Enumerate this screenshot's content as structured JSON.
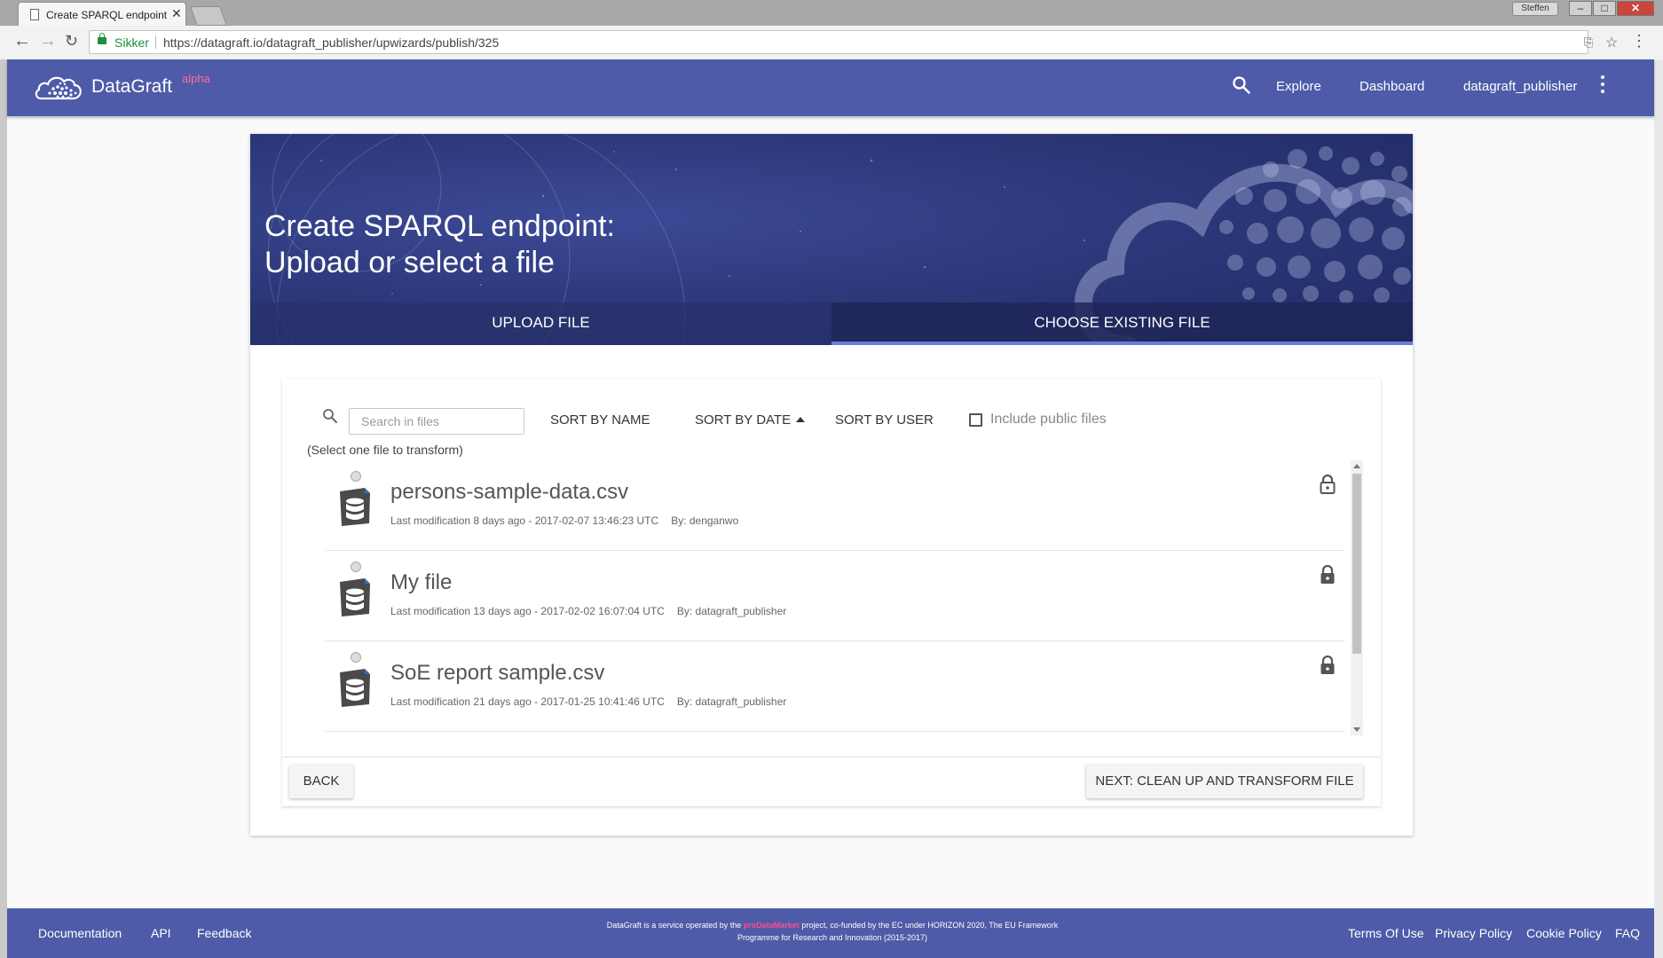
{
  "browser": {
    "tab_title": "Create SPARQL endpoint",
    "user_badge": "Steffen",
    "secure_label": "Sikker",
    "url": "https://datagraft.io/datagraft_publisher/upwizards/publish/325"
  },
  "header": {
    "brand": "DataGraft",
    "brand_sup": "alpha",
    "nav": [
      "Explore",
      "Dashboard",
      "datagraft_publisher"
    ]
  },
  "hero": {
    "title_line1": "Create SPARQL endpoint:",
    "title_line2": "Upload or select a file",
    "tabs": [
      "UPLOAD FILE",
      "CHOOSE EXISTING FILE"
    ],
    "active_tab": "CHOOSE EXISTING FILE"
  },
  "filters": {
    "search_placeholder": "Search in files",
    "sort_name": "SORT BY NAME",
    "sort_date": "SORT BY DATE",
    "sort_user": "SORT BY USER",
    "include_public": "Include public files",
    "include_public_checked": false,
    "hint": "(Select one file to transform)"
  },
  "files": [
    {
      "name": "persons-sample-data.csv",
      "modified": "Last modification 8 days ago - 2017-02-07 13:46:23 UTC",
      "by": "By: denganwo",
      "lock": "unlocked"
    },
    {
      "name": "My file",
      "modified": "Last modification 13 days ago - 2017-02-02 16:07:04 UTC",
      "by": "By: datagraft_publisher",
      "lock": "locked"
    },
    {
      "name": "SoE report sample.csv",
      "modified": "Last modification 21 days ago - 2017-01-25 10:41:46 UTC",
      "by": "By: datagraft_publisher",
      "lock": "locked"
    }
  ],
  "actions": {
    "back": "BACK",
    "next": "NEXT: CLEAN UP AND TRANSFORM FILE"
  },
  "footer": {
    "left_links": [
      "Documentation",
      "API",
      "Feedback"
    ],
    "center_pre": "DataGraft is a service operated by the ",
    "center_project": "proDataMarket",
    "center_post": " project, co-funded by the EC under HORIZON 2020, The EU Framework Programme for Research and Innovation (2015-2017)",
    "right_links": [
      "Terms Of Use",
      "Privacy Policy",
      "Cookie Policy",
      "FAQ"
    ]
  },
  "colors": {
    "header_bg": "#4d5ba8",
    "accent_pink": "#ff4d8a",
    "active_tab_underline": "#6b7bd6",
    "secure_green": "#1e8e3e"
  }
}
